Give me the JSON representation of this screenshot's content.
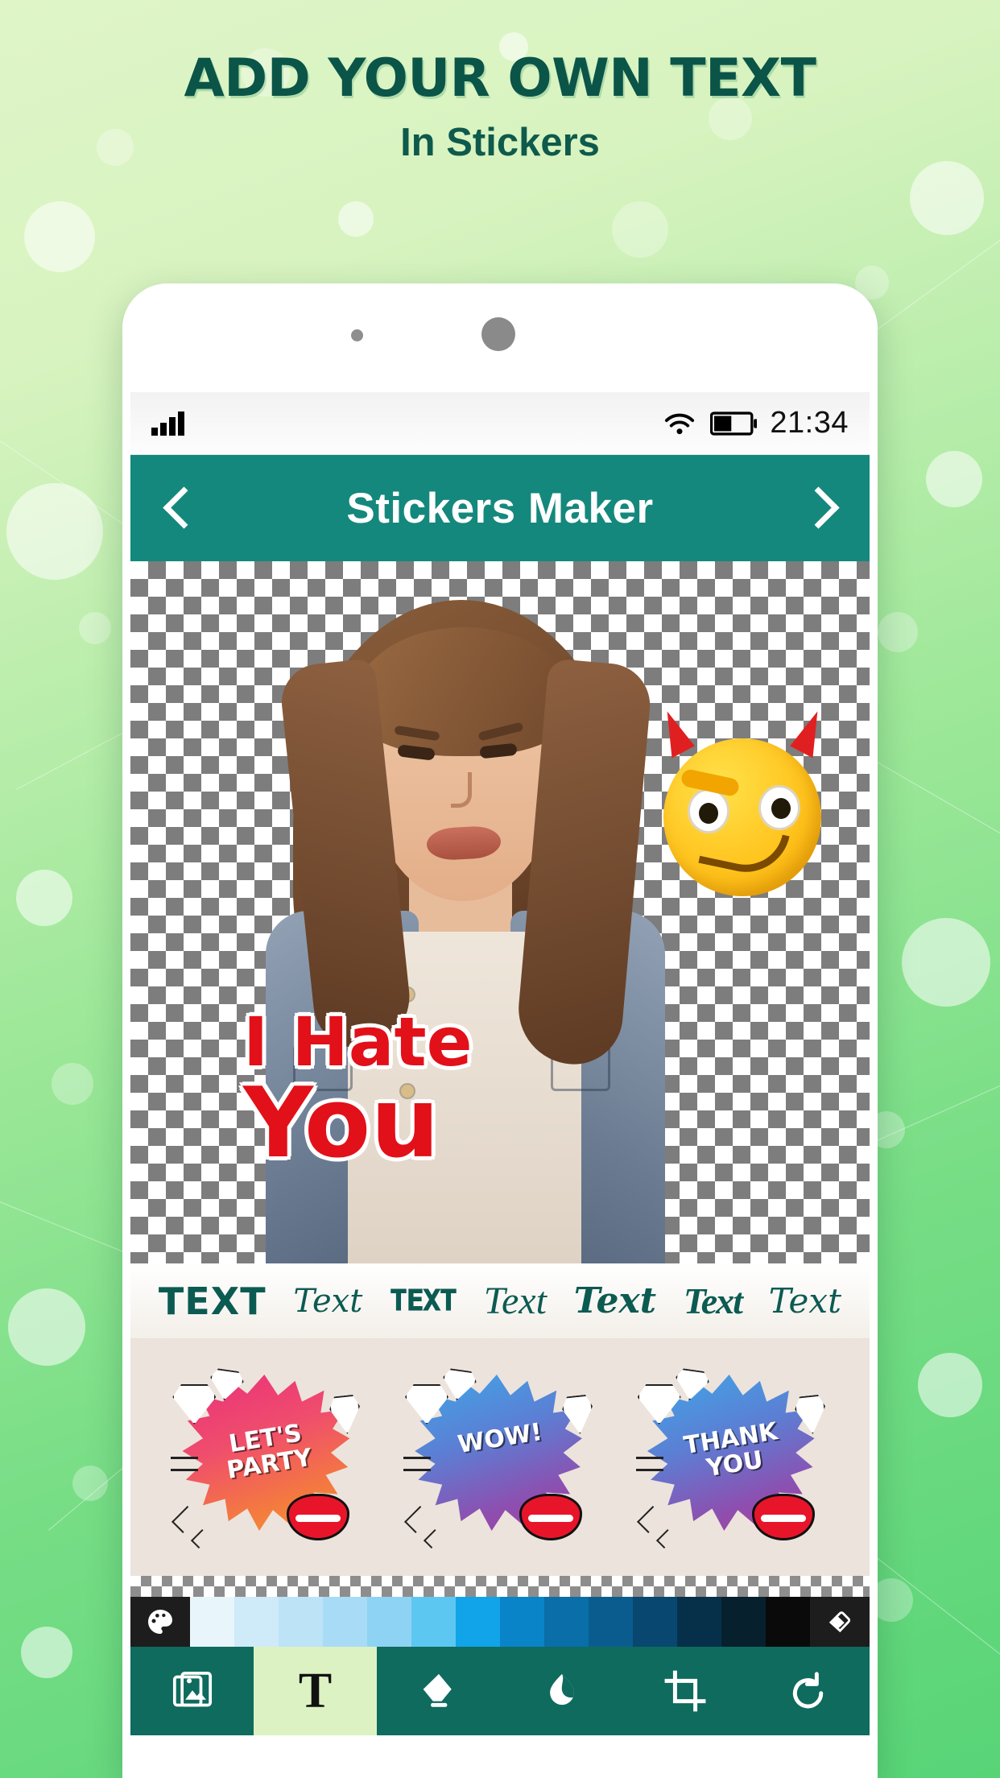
{
  "promo": {
    "title": "ADD YOUR OWN TEXT",
    "subtitle": "In Stickers",
    "title_color": "#0b5448"
  },
  "phone": {
    "status_bar": {
      "signal_icon": "signal-bars-icon",
      "wifi_icon": "wifi-icon",
      "battery_icon": "battery-icon",
      "time": "21:34"
    },
    "app_bar": {
      "back_icon": "chevron-left-icon",
      "title": "Stickers Maker",
      "forward_icon": "chevron-right-icon",
      "background_color": "#14887c"
    },
    "canvas": {
      "background": "transparent-checkerboard",
      "overlay_text_line1": "I Hate",
      "overlay_text_line2": "You",
      "overlay_text_color": "#e21019",
      "overlay_text_outline": "#ffffff",
      "emoji_sticker": "smiling-imp-emoji"
    },
    "font_styles": [
      {
        "label": "TEXT",
        "style": "bold-sans"
      },
      {
        "label": "Text",
        "style": "serif-italic"
      },
      {
        "label": "TEXT",
        "style": "slab-outline"
      },
      {
        "label": "Text",
        "style": "script-light"
      },
      {
        "label": "Text",
        "style": "script-bold"
      },
      {
        "label": "Text",
        "style": "decorative-script"
      },
      {
        "label": "Text",
        "style": "serif-italic-thin"
      }
    ],
    "sticker_gallery": [
      {
        "label": "LET'S\nPARTY",
        "gradient_from": "#ea2f7a",
        "gradient_to": "#f79a33"
      },
      {
        "label": "WOW!",
        "gradient_from": "#3fa7e8",
        "gradient_to": "#a63fa0"
      },
      {
        "label": "THANK\nYOU",
        "gradient_from": "#3fa7e8",
        "gradient_to": "#b43d92"
      }
    ],
    "color_palette": {
      "left_icon": "color-palette-icon",
      "right_icon": "paint-bucket-icon",
      "swatches": [
        "#e8f6fc",
        "#cfeaf8",
        "#bde3f7",
        "#a8dbf5",
        "#8fd3f4",
        "#5cc8f2",
        "#11a4e8",
        "#0a84c8",
        "#0a6ea8",
        "#0a5c8f",
        "#08476f",
        "#063049",
        "#06202e",
        "#0a0a0a"
      ]
    },
    "toolbar": [
      {
        "name": "gallery",
        "icon": "image-stack-icon",
        "active": false
      },
      {
        "name": "text",
        "icon": "text-tool-icon",
        "active": true
      },
      {
        "name": "eraser",
        "icon": "eraser-icon",
        "active": false
      },
      {
        "name": "blur",
        "icon": "droplet-icon",
        "active": false
      },
      {
        "name": "crop",
        "icon": "crop-icon",
        "active": false
      },
      {
        "name": "undo",
        "icon": "undo-icon",
        "active": false
      }
    ]
  }
}
